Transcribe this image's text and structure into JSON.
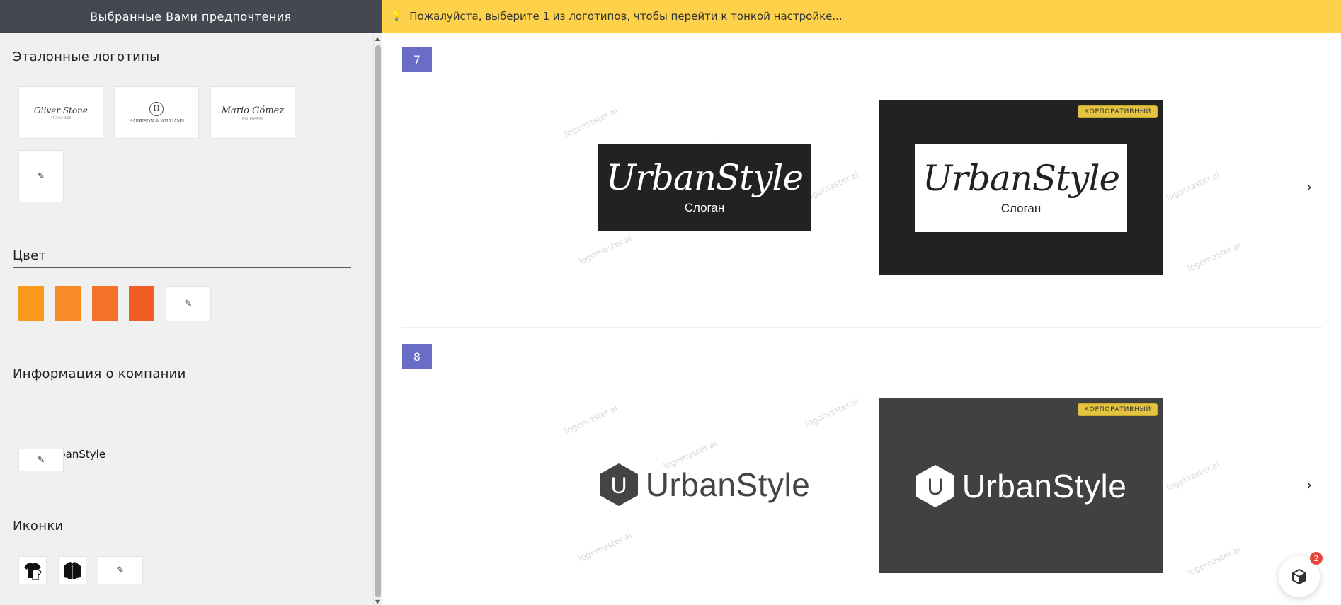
{
  "sidebar": {
    "header": "Выбранные Вами предпочтения",
    "sections": {
      "reference_logos": {
        "title": "Эталонные логотипы",
        "items": [
          {
            "name": "Oliver Stone",
            "subtitle": "STUDIO · SIDE"
          },
          {
            "name": "HARRISON & WILLIAMS",
            "monogram": "H"
          },
          {
            "name": "Mario Gómez",
            "subtitle": "PHOTOGRAPHY"
          }
        ]
      },
      "color": {
        "title": "Цвет",
        "swatches": [
          "#f99a1c",
          "#f88b25",
          "#f57028",
          "#f25d26"
        ]
      },
      "company_info": {
        "title": "Информация о компании",
        "items": [
          "UrbanStyle"
        ]
      },
      "icons": {
        "title": "Иконки",
        "items": [
          "tshirt-icon",
          "jacket-icon"
        ]
      }
    },
    "edit_icon": "edit-icon"
  },
  "notice": {
    "text": "Пожалуйста, выберите 1 из логотипов, чтобы перейти к тонкой настройке..."
  },
  "main": {
    "watermark": "logomaster.ai",
    "rows": [
      {
        "number": "7",
        "logo_name": "UrbanStyle",
        "slogan": "Слоган",
        "badge": "КОРПОРАТИВНЫЙ"
      },
      {
        "number": "8",
        "logo_name": "UrbanStyle",
        "monogram": "U",
        "badge": "КОРПОРАТИВНЫЙ"
      }
    ]
  },
  "chat": {
    "badge_count": "2"
  }
}
